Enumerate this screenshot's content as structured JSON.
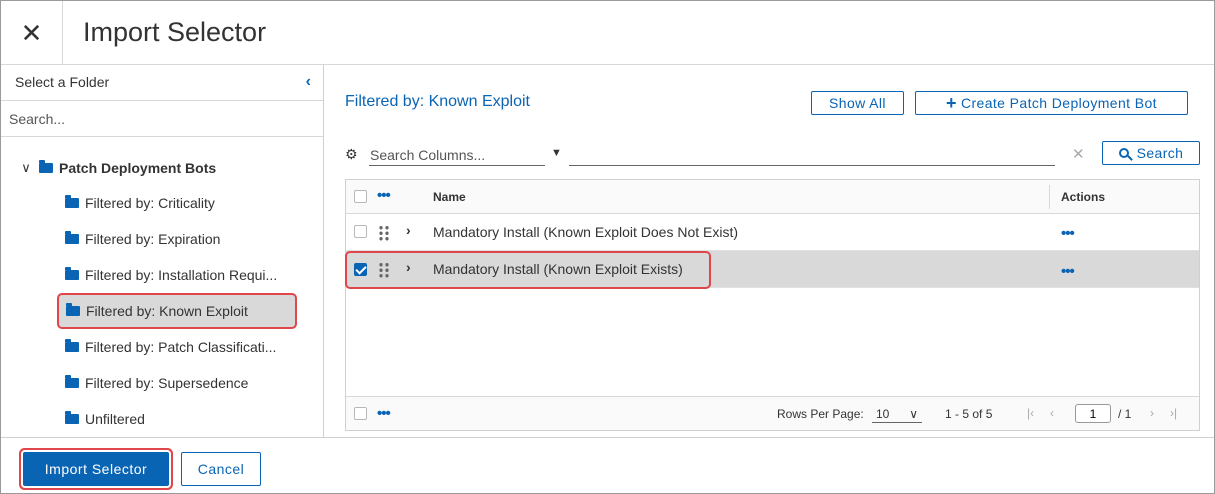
{
  "dialog": {
    "title": "Import Selector",
    "close_glyph": "✕"
  },
  "sidebar": {
    "header_label": "Select a Folder",
    "collapse_glyph": "‹",
    "search_placeholder": "Search...",
    "root": {
      "label": "Patch Deployment Bots",
      "expanded": true
    },
    "items": [
      {
        "label": "Filtered by: Criticality",
        "selected": false
      },
      {
        "label": "Filtered by: Expiration",
        "selected": false
      },
      {
        "label": "Filtered by: Installation Requi...",
        "selected": false
      },
      {
        "label": "Filtered by: Known Exploit",
        "selected": true
      },
      {
        "label": "Filtered by: Patch Classificati...",
        "selected": false
      },
      {
        "label": "Filtered by: Supersedence",
        "selected": false
      },
      {
        "label": "Unfiltered",
        "selected": false
      }
    ]
  },
  "main": {
    "title": "Filtered by: Known Exploit",
    "show_all_label": "Show All",
    "create_label": "Create Patch Deployment Bot",
    "search_columns_placeholder": "Search Columns...",
    "search_button_label": "Search",
    "clear_glyph": "✕",
    "table": {
      "columns": [
        "Name",
        "Actions"
      ],
      "rows": [
        {
          "name": "Mandatory Install (Known Exploit Does Not Exist)",
          "checked": false,
          "actions": "•••"
        },
        {
          "name": "Mandatory Install (Known Exploit Exists)",
          "checked": true,
          "actions": "•••"
        }
      ],
      "footer": {
        "rows_per_page_label": "Rows Per Page:",
        "rows_per_page_value": "10",
        "range_text": "1 - 5 of 5",
        "page_value": "1",
        "page_total": "/ 1"
      }
    }
  },
  "footer": {
    "import_label": "Import Selector",
    "cancel_label": "Cancel"
  },
  "colors": {
    "accent": "#0a64b4",
    "highlight_border": "#e0474c",
    "selected_bg": "#d9d9d9"
  }
}
